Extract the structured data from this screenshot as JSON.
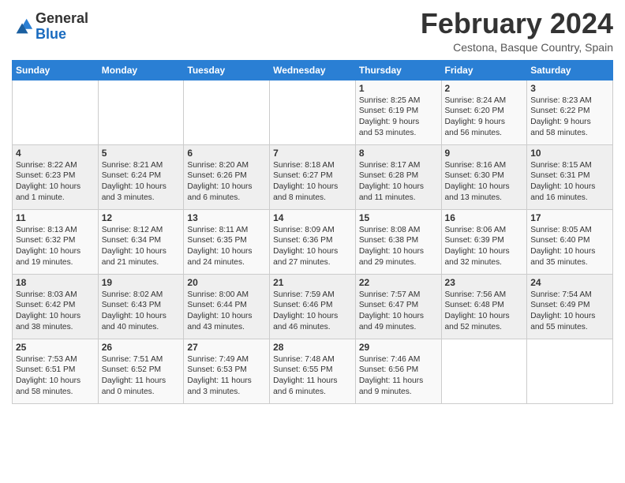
{
  "header": {
    "logo_general": "General",
    "logo_blue": "Blue",
    "month_title": "February 2024",
    "location": "Cestona, Basque Country, Spain"
  },
  "weekdays": [
    "Sunday",
    "Monday",
    "Tuesday",
    "Wednesday",
    "Thursday",
    "Friday",
    "Saturday"
  ],
  "weeks": [
    [
      {
        "day": "",
        "info": ""
      },
      {
        "day": "",
        "info": ""
      },
      {
        "day": "",
        "info": ""
      },
      {
        "day": "",
        "info": ""
      },
      {
        "day": "1",
        "info": "Sunrise: 8:25 AM\nSunset: 6:19 PM\nDaylight: 9 hours\nand 53 minutes."
      },
      {
        "day": "2",
        "info": "Sunrise: 8:24 AM\nSunset: 6:20 PM\nDaylight: 9 hours\nand 56 minutes."
      },
      {
        "day": "3",
        "info": "Sunrise: 8:23 AM\nSunset: 6:22 PM\nDaylight: 9 hours\nand 58 minutes."
      }
    ],
    [
      {
        "day": "4",
        "info": "Sunrise: 8:22 AM\nSunset: 6:23 PM\nDaylight: 10 hours\nand 1 minute."
      },
      {
        "day": "5",
        "info": "Sunrise: 8:21 AM\nSunset: 6:24 PM\nDaylight: 10 hours\nand 3 minutes."
      },
      {
        "day": "6",
        "info": "Sunrise: 8:20 AM\nSunset: 6:26 PM\nDaylight: 10 hours\nand 6 minutes."
      },
      {
        "day": "7",
        "info": "Sunrise: 8:18 AM\nSunset: 6:27 PM\nDaylight: 10 hours\nand 8 minutes."
      },
      {
        "day": "8",
        "info": "Sunrise: 8:17 AM\nSunset: 6:28 PM\nDaylight: 10 hours\nand 11 minutes."
      },
      {
        "day": "9",
        "info": "Sunrise: 8:16 AM\nSunset: 6:30 PM\nDaylight: 10 hours\nand 13 minutes."
      },
      {
        "day": "10",
        "info": "Sunrise: 8:15 AM\nSunset: 6:31 PM\nDaylight: 10 hours\nand 16 minutes."
      }
    ],
    [
      {
        "day": "11",
        "info": "Sunrise: 8:13 AM\nSunset: 6:32 PM\nDaylight: 10 hours\nand 19 minutes."
      },
      {
        "day": "12",
        "info": "Sunrise: 8:12 AM\nSunset: 6:34 PM\nDaylight: 10 hours\nand 21 minutes."
      },
      {
        "day": "13",
        "info": "Sunrise: 8:11 AM\nSunset: 6:35 PM\nDaylight: 10 hours\nand 24 minutes."
      },
      {
        "day": "14",
        "info": "Sunrise: 8:09 AM\nSunset: 6:36 PM\nDaylight: 10 hours\nand 27 minutes."
      },
      {
        "day": "15",
        "info": "Sunrise: 8:08 AM\nSunset: 6:38 PM\nDaylight: 10 hours\nand 29 minutes."
      },
      {
        "day": "16",
        "info": "Sunrise: 8:06 AM\nSunset: 6:39 PM\nDaylight: 10 hours\nand 32 minutes."
      },
      {
        "day": "17",
        "info": "Sunrise: 8:05 AM\nSunset: 6:40 PM\nDaylight: 10 hours\nand 35 minutes."
      }
    ],
    [
      {
        "day": "18",
        "info": "Sunrise: 8:03 AM\nSunset: 6:42 PM\nDaylight: 10 hours\nand 38 minutes."
      },
      {
        "day": "19",
        "info": "Sunrise: 8:02 AM\nSunset: 6:43 PM\nDaylight: 10 hours\nand 40 minutes."
      },
      {
        "day": "20",
        "info": "Sunrise: 8:00 AM\nSunset: 6:44 PM\nDaylight: 10 hours\nand 43 minutes."
      },
      {
        "day": "21",
        "info": "Sunrise: 7:59 AM\nSunset: 6:46 PM\nDaylight: 10 hours\nand 46 minutes."
      },
      {
        "day": "22",
        "info": "Sunrise: 7:57 AM\nSunset: 6:47 PM\nDaylight: 10 hours\nand 49 minutes."
      },
      {
        "day": "23",
        "info": "Sunrise: 7:56 AM\nSunset: 6:48 PM\nDaylight: 10 hours\nand 52 minutes."
      },
      {
        "day": "24",
        "info": "Sunrise: 7:54 AM\nSunset: 6:49 PM\nDaylight: 10 hours\nand 55 minutes."
      }
    ],
    [
      {
        "day": "25",
        "info": "Sunrise: 7:53 AM\nSunset: 6:51 PM\nDaylight: 10 hours\nand 58 minutes."
      },
      {
        "day": "26",
        "info": "Sunrise: 7:51 AM\nSunset: 6:52 PM\nDaylight: 11 hours\nand 0 minutes."
      },
      {
        "day": "27",
        "info": "Sunrise: 7:49 AM\nSunset: 6:53 PM\nDaylight: 11 hours\nand 3 minutes."
      },
      {
        "day": "28",
        "info": "Sunrise: 7:48 AM\nSunset: 6:55 PM\nDaylight: 11 hours\nand 6 minutes."
      },
      {
        "day": "29",
        "info": "Sunrise: 7:46 AM\nSunset: 6:56 PM\nDaylight: 11 hours\nand 9 minutes."
      },
      {
        "day": "",
        "info": ""
      },
      {
        "day": "",
        "info": ""
      }
    ]
  ]
}
